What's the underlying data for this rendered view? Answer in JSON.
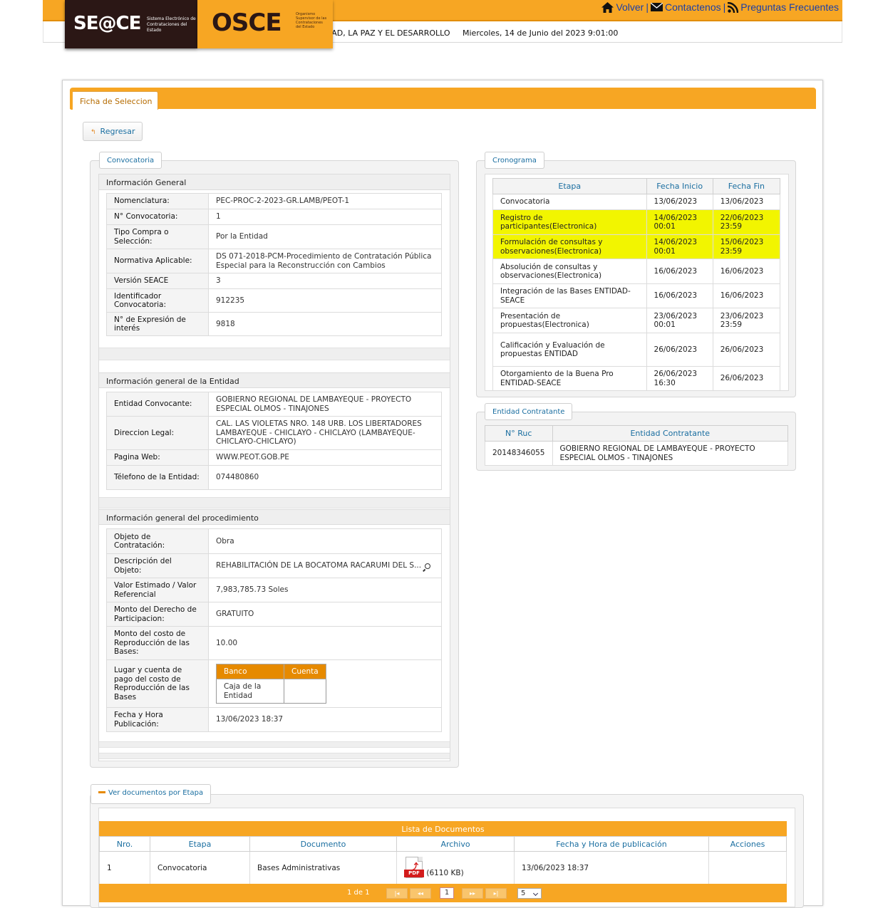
{
  "header": {
    "seace_logo": "SE@CE",
    "seace_tagline": "Sistema Electrónico de Contrataciones del Estado",
    "osce_logo": "OSCE",
    "osce_tagline": "Organismo Supervisor de las Contrataciones del Estado",
    "motto": "DAD, LA PAZ Y EL DESARROLLO",
    "datetime": "Miercoles, 14 de Junio del 2023  9:01:00",
    "links": [
      {
        "label": "Volver",
        "icon": "home-icon"
      },
      {
        "label": "Contactenos",
        "icon": "mail-icon"
      },
      {
        "label": "Preguntas Frecuentes",
        "icon": "rss-icon"
      }
    ],
    "separator": "|"
  },
  "tab": {
    "label": "Ficha de Seleccion"
  },
  "back_button": {
    "label": "Regresar"
  },
  "convocatoria": {
    "legend": "Convocatoria",
    "info_general": {
      "title": "Información General",
      "rows": [
        {
          "k": "Nomenclatura:",
          "v": "PEC-PROC-2-2023-GR.LAMB/PEOT-1"
        },
        {
          "k": "N° Convocatoria:",
          "v": "1"
        },
        {
          "k": "Tipo Compra o Selección:",
          "v": "Por la Entidad"
        },
        {
          "k": "Normativa Aplicable:",
          "v": "DS 071-2018-PCM-Procedimiento de Contratación Pública Especial para la Reconstrucción con Cambios"
        },
        {
          "k": "Versión SEACE",
          "v": "3"
        },
        {
          "k": "Identificador Convocatoria:",
          "v": "912235"
        },
        {
          "k": "N° de Expresión de interés",
          "v": "9818"
        }
      ]
    },
    "info_entidad": {
      "title": "Información general de la Entidad",
      "rows": [
        {
          "k": "Entidad Convocante:",
          "v": "GOBIERNO REGIONAL DE LAMBAYEQUE - PROYECTO ESPECIAL OLMOS - TINAJONES"
        },
        {
          "k": "Direccion Legal:",
          "v": "CAL. LAS VIOLETAS NRO. 148 URB. LOS LIBERTADORES LAMBAYEQUE - CHICLAYO - CHICLAYO (LAMBAYEQUE-CHICLAYO-CHICLAYO)"
        },
        {
          "k": "Pagina Web:",
          "v": "WWW.PEOT.GOB.PE"
        },
        {
          "k": "Télefono de la Entidad:",
          "v": "074480860"
        }
      ]
    },
    "info_procedimiento": {
      "title": "Información general del procedimiento",
      "rows": [
        {
          "k": "Objeto de Contratación:",
          "v": "Obra"
        },
        {
          "k": "Descripción del Objeto:",
          "v": "REHABILITACIÓN DE LA BOCATOMA RACARUMI DEL S..."
        },
        {
          "k": "Valor Estimado / Valor Referencial",
          "v": "7,983,785.73  Soles"
        },
        {
          "k": "Monto del Derecho de Participacion:",
          "v": "GRATUITO"
        },
        {
          "k": "Monto del costo de Reproducción de las Bases:",
          "v": "10.00"
        },
        {
          "k": "Lugar y cuenta de pago del costo de Reproducción de las Bases",
          "v": ""
        },
        {
          "k": "Fecha y Hora Publicación:",
          "v": "13/06/2023 18:37"
        }
      ],
      "pago": {
        "headers": [
          "Banco",
          "Cuenta"
        ],
        "banco": "Caja de la Entidad",
        "cuenta": ""
      }
    }
  },
  "cronograma": {
    "legend": "Cronograma",
    "headers": [
      "Etapa",
      "Fecha Inicio",
      "Fecha Fin"
    ],
    "rows": [
      {
        "etapa": "Convocatoria",
        "inicio": "13/06/2023",
        "fin": "13/06/2023",
        "highlight": false
      },
      {
        "etapa": "Registro de participantes(Electronica)",
        "inicio": "14/06/2023 00:01",
        "fin": "22/06/2023 23:59",
        "highlight": true
      },
      {
        "etapa": "Formulación de consultas y observaciones(Electronica)",
        "inicio": "14/06/2023 00:01",
        "fin": "15/06/2023 23:59",
        "highlight": true
      },
      {
        "etapa": "Absolución de consultas y observaciones(Electronica)",
        "inicio": "16/06/2023",
        "fin": "16/06/2023",
        "highlight": false
      },
      {
        "etapa": "Integración de las Bases ENTIDAD-SEACE",
        "inicio": "16/06/2023",
        "fin": "16/06/2023",
        "highlight": false
      },
      {
        "etapa": "Presentación de propuestas(Electronica)",
        "inicio": "23/06/2023 00:01",
        "fin": "23/06/2023 23:59",
        "highlight": false
      },
      {
        "etapa": "Calificación y Evaluación de propuestas ENTIDAD",
        "inicio": "26/06/2023",
        "fin": "26/06/2023",
        "highlight": false
      },
      {
        "etapa": "Otorgamiento de la Buena Pro ENTIDAD-SEACE",
        "inicio": "26/06/2023 16:30",
        "fin": "26/06/2023",
        "highlight": false
      }
    ]
  },
  "entidad_contratante": {
    "legend": "Entidad Contratante",
    "headers": [
      "N° Ruc",
      "Entidad Contratante"
    ],
    "ruc": "20148346055",
    "nombre": "GOBIERNO REGIONAL DE LAMBAYEQUE - PROYECTO ESPECIAL OLMOS - TINAJONES"
  },
  "documentos": {
    "legend": "Ver documentos por Etapa",
    "title": "Lista de Documentos",
    "headers": [
      "Nro.",
      "Etapa",
      "Documento",
      "Archivo",
      "Fecha y Hora de publicación",
      "Acciones"
    ],
    "rows": [
      {
        "nro": "1",
        "etapa": "Convocatoria",
        "documento": "Bases Administrativas",
        "archivo_icon": "pdf-icon",
        "archivo_label": "PDF",
        "archivo_size": "(6110 KB)",
        "fecha": "13/06/2023 18:37",
        "acciones": ""
      }
    ],
    "pager": {
      "info": "1 de 1",
      "current_page": "1",
      "page_size": "5",
      "first": "|◂",
      "prev": "◂◂",
      "next": "▸▸",
      "last": "▸|"
    }
  }
}
